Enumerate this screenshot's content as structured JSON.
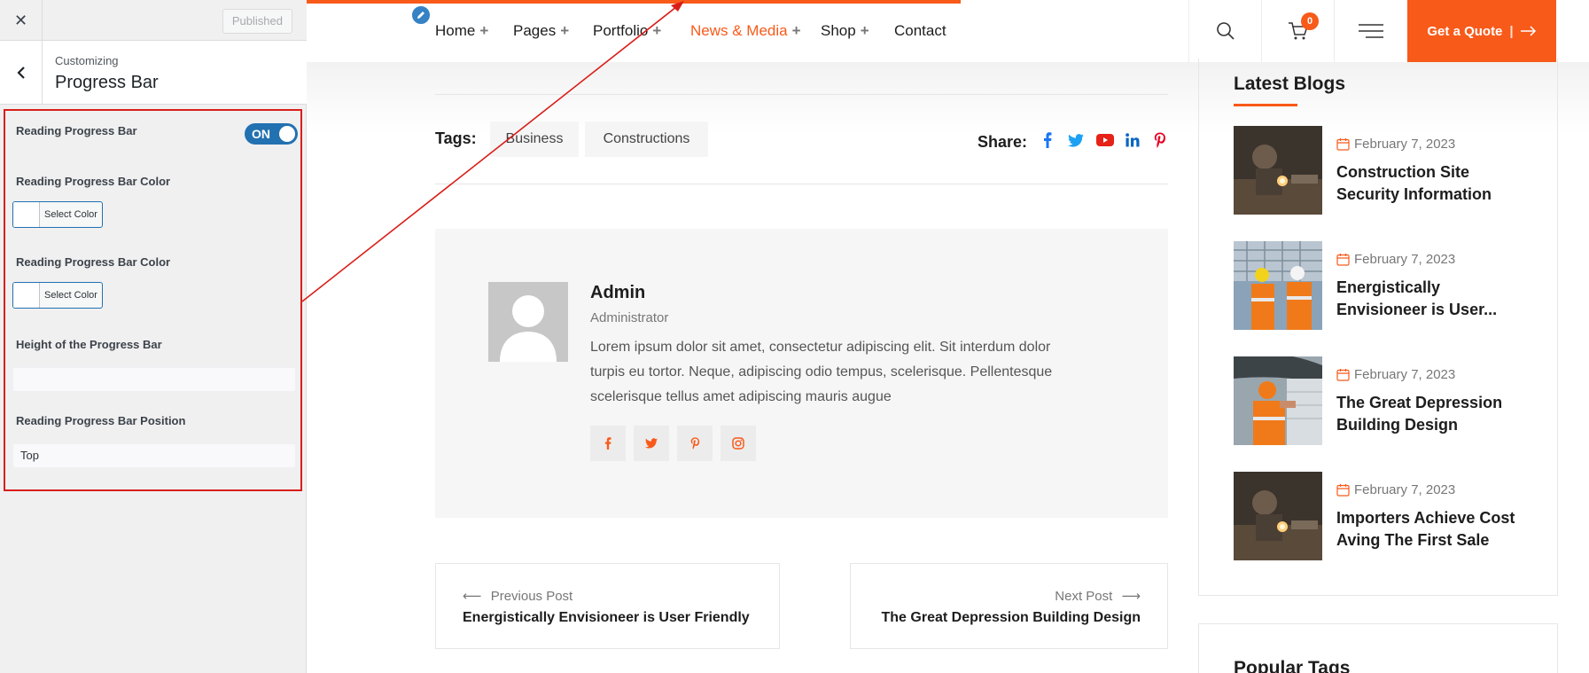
{
  "customizer": {
    "published_label": "Published",
    "breadcrumb": "Customizing",
    "section_title": "Progress Bar",
    "settings": {
      "enable_label": "Reading Progress Bar",
      "toggle_state": "ON",
      "color1_label": "Reading Progress Bar Color",
      "color1_button": "Select Color",
      "color2_label": "Reading Progress Bar Color",
      "color2_button": "Select Color",
      "height_label": "Height of the Progress Bar",
      "height_value": "",
      "position_label": "Reading Progress Bar Position",
      "position_value": "Top"
    }
  },
  "site": {
    "progress_fraction": 0.51,
    "accent_color": "#f85a1a",
    "nav": [
      "Home",
      "Pages",
      "Portfolio",
      "News & Media",
      "Shop",
      "Contact"
    ],
    "nav_active": "News & Media",
    "cart_count": "0",
    "quote_label": "Get a Quote",
    "tags_label": "Tags:",
    "tags": [
      "Business",
      "Constructions"
    ],
    "share_label": "Share:",
    "author": {
      "name": "Admin",
      "role": "Administrator",
      "bio": "Lorem ipsum dolor sit amet, consectetur adipiscing elit. Sit interdum dolor turpis eu tortor. Neque, adipiscing odio tempus, scelerisque. Pellentesque scelerisque tellus amet adipiscing mauris augue"
    },
    "prev": {
      "label": "Previous Post",
      "title": "Energistically Envisioneer is User Friendly"
    },
    "next": {
      "label": "Next Post",
      "title": "The Great Depression Building Design"
    },
    "latest_title": "Latest Blogs",
    "blogs": [
      {
        "date": "February 7, 2023",
        "title": "Construction Site Security Information"
      },
      {
        "date": "February 7, 2023",
        "title": "Energistically Envisioneer is User..."
      },
      {
        "date": "February 7, 2023",
        "title": "The Great Depression Building Design"
      },
      {
        "date": "February 7, 2023",
        "title": "Importers Achieve Cost Aving The First Sale"
      }
    ],
    "popular_title": "Popular Tags"
  }
}
